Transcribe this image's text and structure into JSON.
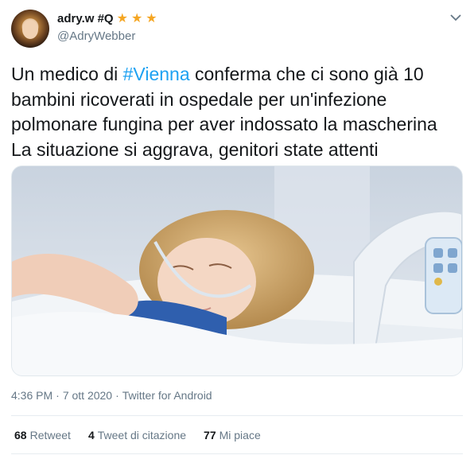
{
  "author": {
    "display_name": "adry.w #Q",
    "handle": "@AdryWebber",
    "badges": [
      "star-icon",
      "star-icon",
      "star-icon"
    ]
  },
  "tweet": {
    "text_before_hashtag": "Un medico  di ",
    "hashtag": "#Vienna",
    "text_after_hashtag": " conferma che ci sono già 10 bambini ricoverati in ospedale per un'infezione polmonare fungina per aver indossato la mascherina\nLa situazione si aggrava, genitori state attenti",
    "time": "4:36 PM",
    "separator": "·",
    "date": "7 ott 2020",
    "separator2": "·",
    "source": "Twitter for Android"
  },
  "stats": {
    "retweets_count": "68",
    "retweets_label": "Retweet",
    "quotes_count": "4",
    "quotes_label": "Tweet di citazione",
    "likes_count": "77",
    "likes_label": "Mi piace"
  },
  "colors": {
    "link": "#1da1f2",
    "secondary_text": "#657786",
    "star": "#f5a623"
  }
}
